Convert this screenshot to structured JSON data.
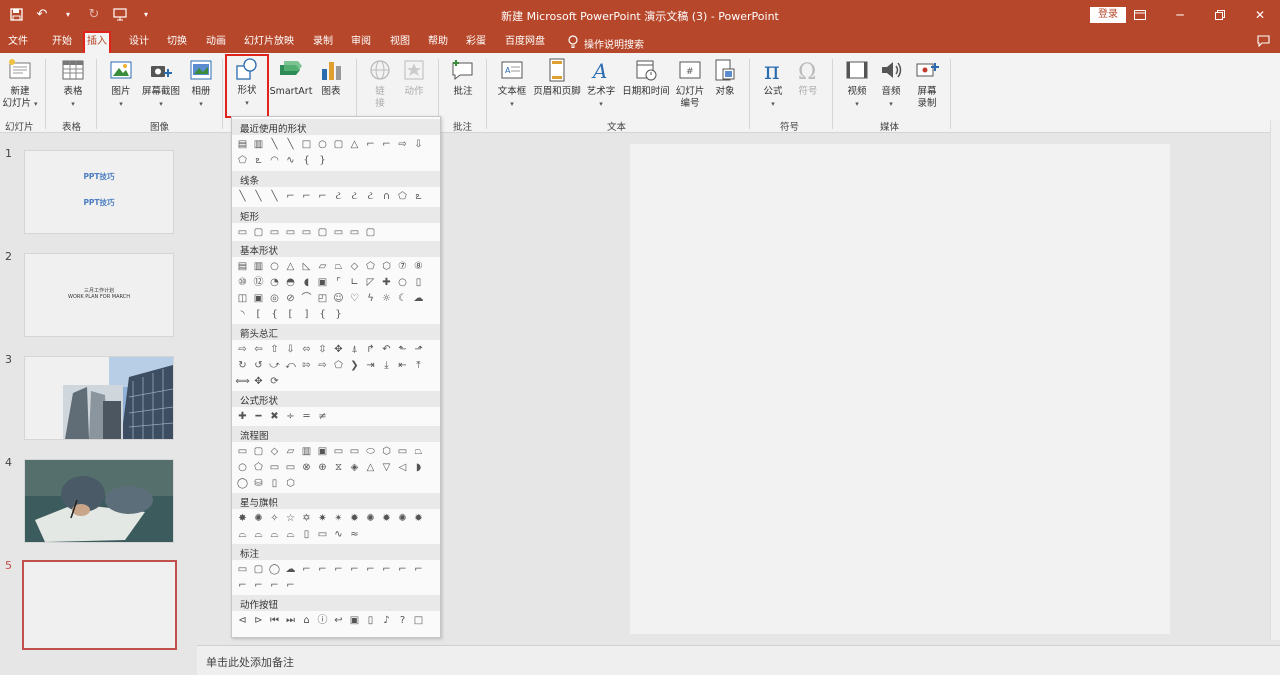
{
  "window": {
    "title": "新建 Microsoft PowerPoint 演示文稿 (3)  -  PowerPoint",
    "login_label": "登录"
  },
  "menu": {
    "tabs": [
      "文件",
      "开始",
      "插入",
      "设计",
      "切换",
      "动画",
      "幻灯片放映",
      "录制",
      "审阅",
      "视图",
      "帮助",
      "彩蛋",
      "百度网盘"
    ],
    "active": "插入",
    "tell_me": "操作说明搜索"
  },
  "ribbon": {
    "new_slide_1": "新建",
    "new_slide_2": "幻灯片",
    "table": "表格",
    "picture": "图片",
    "screenshot": "屏幕截图",
    "album": "相册",
    "shapes": "形状",
    "smartart": "SmartArt",
    "chart": "图表",
    "link_1": "链",
    "link_2": "接",
    "action": "动作",
    "comment": "批注",
    "textbox": "文本框",
    "header_footer": "页眉和页脚",
    "wordart": "艺术字",
    "datetime": "日期和时间",
    "slide_number_1": "幻灯片",
    "slide_number_2": "编号",
    "object": "对象",
    "equation": "公式",
    "symbol": "符号",
    "video": "视频",
    "audio": "音频",
    "screen_record_1": "屏幕",
    "screen_record_2": "录制",
    "groups": {
      "slides": "幻灯片",
      "tables": "表格",
      "images": "图像",
      "comments": "批注",
      "text": "文本",
      "symbols": "符号",
      "media": "媒体"
    }
  },
  "shapes_menu": {
    "sections": [
      "最近使用的形状",
      "线条",
      "矩形",
      "基本形状",
      "箭头总汇",
      "公式形状",
      "流程图",
      "星与旗帜",
      "标注",
      "动作按钮"
    ]
  },
  "slides": {
    "numbers": [
      "1",
      "2",
      "3",
      "4",
      "5"
    ],
    "s1_line1": "PPT技巧",
    "s1_line2": "PPT技巧",
    "s2_line1": "三月工作计划",
    "s2_line2": "WORK PLAN FOR MARCH",
    "selected": 5
  },
  "notes_placeholder": "单击此处添加备注",
  "colors": {
    "accent": "#b7472a",
    "highlight": "#e0241c",
    "selected_slide": "#c0504d"
  }
}
